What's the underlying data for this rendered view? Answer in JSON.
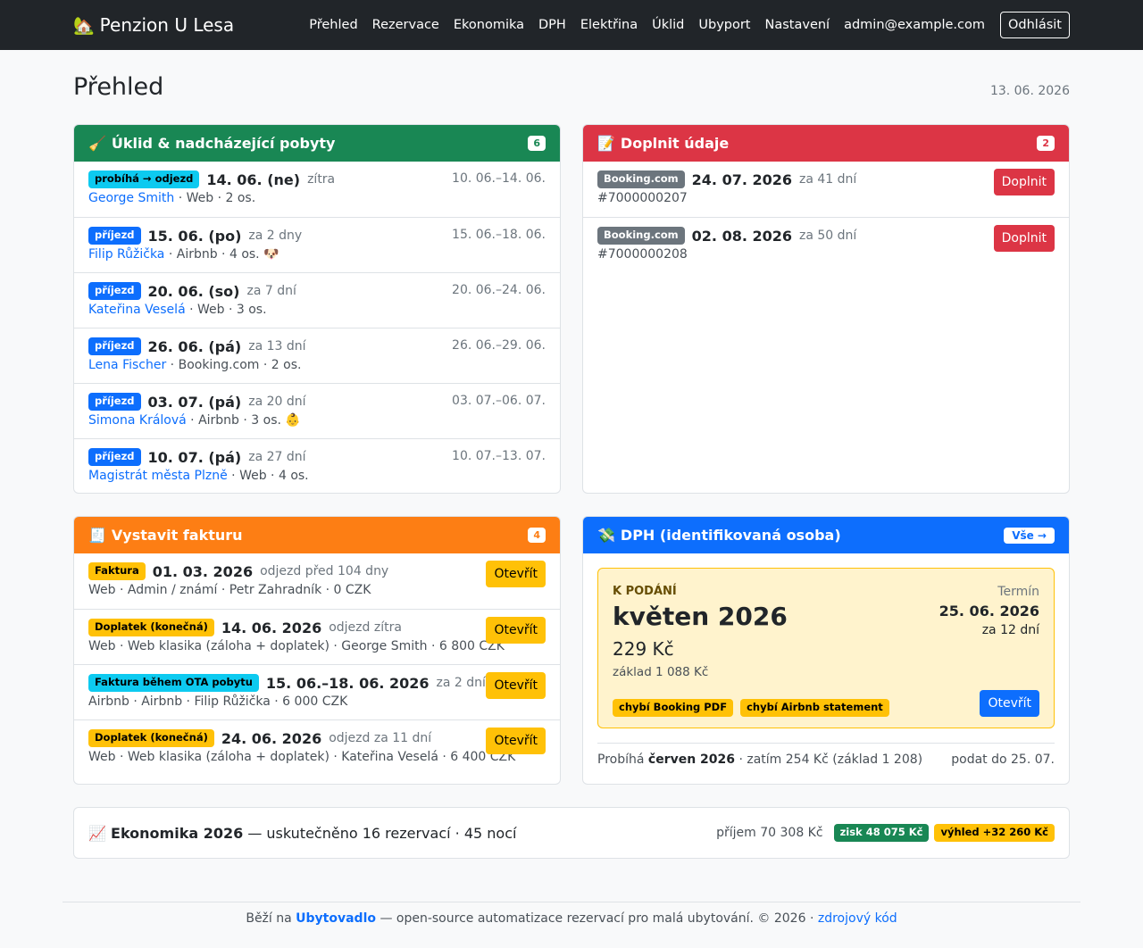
{
  "nav": {
    "brand": "Penzion U Lesa",
    "brand_icon": "house-icon",
    "items": [
      "Přehled",
      "Rezervace",
      "Ekonomika",
      "DPH",
      "Elektřina",
      "Úklid",
      "Ubyport",
      "Nastavení"
    ],
    "user": "admin@example.com",
    "logout": "Odhlásit"
  },
  "page": {
    "title": "Přehled",
    "date": "13. 06. 2026"
  },
  "cleaning": {
    "title": "Úklid & nadcházející pobyty",
    "count": "6",
    "rows": [
      {
        "badge": "probíhá → odjezd",
        "date": "14. 06. (ne)",
        "rel": "zítra",
        "guest": "George Smith",
        "meta": " · Web · 2 os.",
        "range": "10. 06.–14. 06."
      },
      {
        "badge": "příjezd",
        "date": "15. 06. (po)",
        "rel": "za 2 dny",
        "guest": "Filip Růžička",
        "meta": " · Airbnb · 4 os. 🐶",
        "range": "15. 06.–18. 06."
      },
      {
        "badge": "příjezd",
        "date": "20. 06. (so)",
        "rel": "za 7 dní",
        "guest": "Kateřina Veselá",
        "meta": " · Web · 3 os.",
        "range": "20. 06.–24. 06."
      },
      {
        "badge": "příjezd",
        "date": "26. 06. (pá)",
        "rel": "za 13 dní",
        "guest": "Lena Fischer",
        "meta": " · Booking.com · 2 os.",
        "range": "26. 06.–29. 06."
      },
      {
        "badge": "příjezd",
        "date": "03. 07. (pá)",
        "rel": "za 20 dní",
        "guest": "Simona Králová",
        "meta": " · Airbnb · 3 os. 👶",
        "range": "03. 07.–06. 07."
      },
      {
        "badge": "příjezd",
        "date": "10. 07. (pá)",
        "rel": "za 27 dní",
        "guest": "Magistrát města Plzně",
        "meta": " · Web · 4 os.",
        "range": "10. 07.–13. 07."
      }
    ]
  },
  "fill": {
    "title": "Doplnit údaje",
    "count": "2",
    "rows": [
      {
        "badge": "Booking.com",
        "date": "24. 07. 2026",
        "rel": "za 41 dní",
        "ref": "#7000000207",
        "button": "Doplnit"
      },
      {
        "badge": "Booking.com",
        "date": "02. 08. 2026",
        "rel": "za 50 dní",
        "ref": "#7000000208",
        "button": "Doplnit"
      }
    ]
  },
  "invoice": {
    "title": "Vystavit fakturu",
    "count": "4",
    "rows": [
      {
        "badge": "Faktura",
        "date": "01. 03. 2026",
        "rel": "odjezd před 104 dny",
        "meta": "Web · Admin / známí · Petr Zahradník · 0 CZK",
        "button": "Otevřít"
      },
      {
        "badge": "Doplatek (konečná)",
        "date": "14. 06. 2026",
        "rel": "odjezd zítra",
        "meta": "Web · Web klasika (záloha + doplatek) · George Smith · 6 800 CZK",
        "button": "Otevřít"
      },
      {
        "badge": "Faktura během OTA pobytu",
        "date": "15. 06.–18. 06. 2026",
        "rel": "za 2 dní",
        "meta": "Airbnb · Airbnb · Filip Růžička · 6 000 CZK",
        "button": "Otevřít"
      },
      {
        "badge": "Doplatek (konečná)",
        "date": "24. 06. 2026",
        "rel": "odjezd za 11 dní",
        "meta": "Web · Web klasika (záloha + doplatek) · Kateřina Veselá · 6 400 CZK",
        "button": "Otevřít"
      }
    ]
  },
  "vat": {
    "title": "DPH (identifikovaná osoba)",
    "all": "Vše →",
    "label": "K PODÁNÍ",
    "period": "květen 2026",
    "amount": "229 Kč",
    "base": "základ 1 088 Kč",
    "term_label": "Termín",
    "term_date": "25. 06. 2026",
    "term_rel": "za 12 dní",
    "tags": [
      "chybí Booking PDF",
      "chybí Airbnb statement"
    ],
    "open": "Otevřít",
    "foot_prefix": "Probíhá ",
    "foot_period": "červen 2026",
    "foot_rest": " · zatím 254 Kč (základ 1 208)",
    "foot_right": "podat do 25. 07."
  },
  "econ": {
    "title": "Ekonomika 2026",
    "rest": " — uskutečněno 16 rezervací · 45 nocí",
    "income": "příjem 70 308 Kč",
    "profit": "zisk 48 075 Kč",
    "outlook": "výhled +32 260 Kč"
  },
  "footer": {
    "prefix": "Běží na ",
    "app": "Ubytovadlo",
    "middle": " — open-source automatizace rezervací pro malá ubytování. © 2026 · ",
    "source": "zdrojový kód"
  },
  "colors": {
    "cleaning": "#198754",
    "fill": "#dc3545",
    "invoice": "#fd7e14",
    "vat": "#0d6efd"
  }
}
